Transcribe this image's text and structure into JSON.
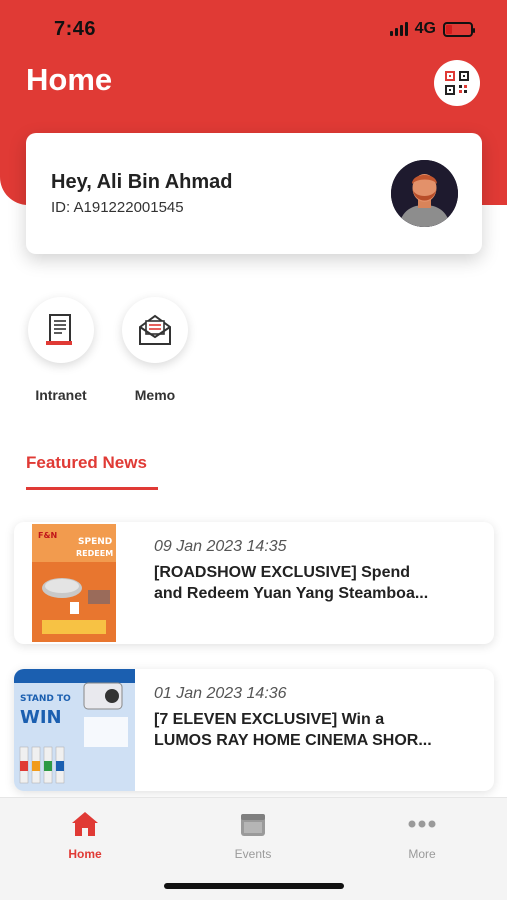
{
  "status_bar": {
    "time": "7:46",
    "network": "4G"
  },
  "header": {
    "title": "Home",
    "qr_icon": "qr-code-icon"
  },
  "profile": {
    "greeting": "Hey, Ali Bin Ahmad",
    "id_text": "ID: A191222001545"
  },
  "shortcuts": [
    {
      "label": "Intranet",
      "icon": "document-icon"
    },
    {
      "label": "Memo",
      "icon": "envelope-icon"
    }
  ],
  "featured": {
    "title": "Featured News",
    "items": [
      {
        "date": "09 Jan 2023 14:35",
        "title_line1": "[ROADSHOW EXCLUSIVE] Spend",
        "title_line2": "and Redeem Yuan Yang Steamboa...",
        "thumb_text_top": "F&N",
        "thumb_text_main": "SPEND",
        "thumb_text_sub": "REDEEM"
      },
      {
        "date": "01 Jan 2023 14:36",
        "title_line1": "[7 ELEVEN EXCLUSIVE] Win a",
        "title_line2": "LUMOS RAY HOME CINEMA SHOR...",
        "thumb_text_top": "STAND TO",
        "thumb_text_main": "WIN"
      }
    ]
  },
  "tabs": [
    {
      "label": "Home",
      "icon": "home-icon",
      "active": true
    },
    {
      "label": "Events",
      "icon": "calendar-icon",
      "active": false
    },
    {
      "label": "More",
      "icon": "more-dots-icon",
      "active": false
    }
  ],
  "colors": {
    "brand_red": "#e03a35",
    "inactive_gray": "#9a9a9a"
  }
}
